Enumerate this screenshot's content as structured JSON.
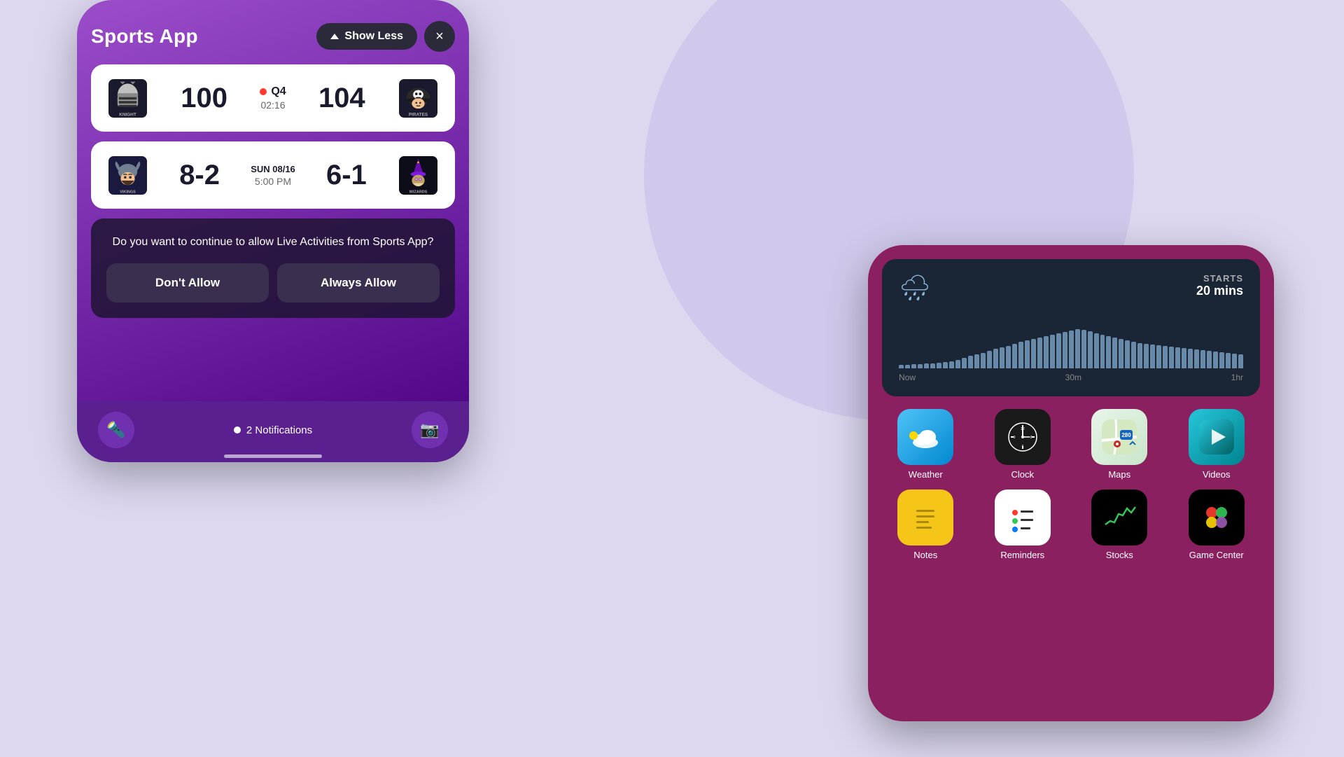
{
  "background": {
    "color": "#ddd8f0"
  },
  "left_phone": {
    "title": "Sports App",
    "show_less_label": "Show Less",
    "close_label": "×",
    "game1": {
      "team1": {
        "name": "Knight",
        "score": "100"
      },
      "status": "Q4",
      "time": "02:16",
      "team2": {
        "name": "Pirates",
        "score": "104"
      }
    },
    "game2": {
      "team1": {
        "name": "Vikings",
        "score": "8-2"
      },
      "date": "SUN 08/16",
      "time": "5:00 PM",
      "team2": {
        "name": "Wizards",
        "score": "6-1"
      }
    },
    "prompt": {
      "question": "Do you want to continue to allow Live Activities from Sports App?",
      "dont_allow": "Don't Allow",
      "always_allow": "Always Allow"
    },
    "bottom": {
      "notifications": "2 Notifications"
    }
  },
  "right_phone": {
    "weather_widget": {
      "starts_label": "STARTS",
      "starts_time": "20 mins",
      "chart_labels": [
        "Now",
        "30m",
        "1hr"
      ]
    },
    "apps_row1": [
      {
        "label": "Weather",
        "color": "weather"
      },
      {
        "label": "Clock",
        "color": "clock"
      },
      {
        "label": "Maps",
        "color": "maps"
      },
      {
        "label": "Videos",
        "color": "videos"
      }
    ],
    "apps_row2": [
      {
        "label": "Notes",
        "color": "notes-yellow"
      },
      {
        "label": "Reminders",
        "color": "reminders"
      },
      {
        "label": "Stocks",
        "color": "stocks"
      },
      {
        "label": "Game Center",
        "color": "games"
      }
    ]
  }
}
